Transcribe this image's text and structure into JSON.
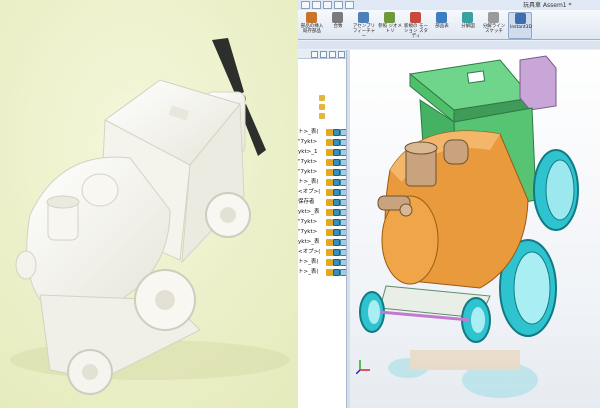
{
  "window": {
    "title": "玩具車 Assem1 *"
  },
  "ribbon": {
    "buttons": [
      {
        "label": "部品の挿入 既存部品",
        "icon": "insert-component-icon",
        "color": "#c9742a"
      },
      {
        "label": "合致",
        "icon": "mate-icon",
        "color": "#7a7a7a"
      },
      {
        "label": "アセンブリ フィーチャー",
        "icon": "assembly-feature-icon",
        "color": "#4f7fb8"
      },
      {
        "label": "参照 ジオメトリ",
        "icon": "reference-geometry-icon",
        "color": "#6f9a3a"
      },
      {
        "label": "新規の モーション スタディ",
        "icon": "motion-study-icon",
        "color": "#c64b3a"
      },
      {
        "label": "部品表",
        "icon": "bom-icon",
        "color": "#3c7fc0"
      },
      {
        "label": "分解図",
        "icon": "exploded-view-icon",
        "color": "#3aa0a0"
      },
      {
        "label": "分解ライン スケッチ",
        "icon": "explode-line-sketch-icon",
        "color": "#9a9a9a"
      },
      {
        "label": "Instant3D",
        "icon": "instant3d-icon",
        "color": "#3b6fb0"
      }
    ]
  },
  "tree": {
    "rows": [
      "ト>_表(",
      "\"7ykt>",
      "ykt>_1",
      "\"7ykt>",
      "\"7ykt>",
      "ト>_表(",
      "<オプ>(",
      "保存者",
      "ykt>_表",
      "\"7ykt>",
      "\"7ykt>",
      "ykt>_表",
      "<オプ>(",
      "ト>_表(",
      "ト>_表("
    ]
  },
  "colors": {
    "model_green": "#4fbf6c",
    "model_orange": "#e89a3c",
    "model_cyan": "#2ec3cf",
    "model_purple": "#c8a6d8",
    "model_tan": "#c8a37e"
  }
}
